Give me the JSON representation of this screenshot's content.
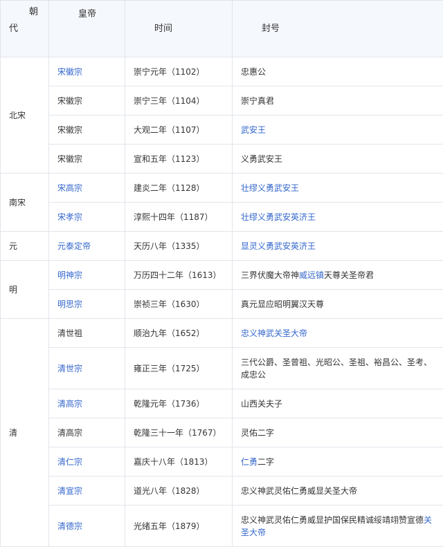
{
  "headers": {
    "dynasty_1": "朝",
    "dynasty_2": "代",
    "emperor": "皇帝",
    "time": "时间",
    "title": "封号"
  },
  "groups": [
    {
      "dynasty": "北宋",
      "rows": [
        {
          "emperor": "宋徽宗",
          "emperor_link": true,
          "time": "崇宁元年（1102）",
          "title": [
            {
              "t": "忠惠公",
              "link": false
            }
          ]
        },
        {
          "emperor": "宋徽宗",
          "emperor_link": false,
          "time": "崇宁三年（1104）",
          "title": [
            {
              "t": "崇宁真君",
              "link": false
            }
          ]
        },
        {
          "emperor": "宋徽宗",
          "emperor_link": false,
          "time": "大观二年（1107）",
          "title": [
            {
              "t": "武安王",
              "link": true
            }
          ]
        },
        {
          "emperor": "宋徽宗",
          "emperor_link": false,
          "time": "宣和五年（1123）",
          "title": [
            {
              "t": "义勇武安王",
              "link": false
            }
          ]
        }
      ]
    },
    {
      "dynasty": "南宋",
      "rows": [
        {
          "emperor": "宋高宗",
          "emperor_link": true,
          "time": "建炎二年（1128）",
          "title": [
            {
              "t": "壮缪义勇武安王",
              "link": true
            }
          ]
        },
        {
          "emperor": "宋孝宗",
          "emperor_link": true,
          "time": "淳熙十四年（1187）",
          "title": [
            {
              "t": "壮缪义勇武安英济王",
              "link": true
            }
          ]
        }
      ]
    },
    {
      "dynasty": "元",
      "rows": [
        {
          "emperor": "元泰定帝",
          "emperor_link": true,
          "time": "天历八年（1335）",
          "title": [
            {
              "t": "显灵义勇武安英济王",
              "link": true
            }
          ]
        }
      ]
    },
    {
      "dynasty": "明",
      "rows": [
        {
          "emperor": "明神宗",
          "emperor_link": true,
          "time": "万历四十二年（1613）",
          "title": [
            {
              "t": "三界伏魔大帝神",
              "link": false
            },
            {
              "t": "威远镇",
              "link": true
            },
            {
              "t": "天尊关圣帝君",
              "link": false
            }
          ]
        },
        {
          "emperor": "明思宗",
          "emperor_link": true,
          "time": "崇祯三年（1630）",
          "title": [
            {
              "t": "真元显应昭明翼汉天尊",
              "link": false
            }
          ]
        }
      ]
    },
    {
      "dynasty": "清",
      "rows": [
        {
          "emperor": "清世祖",
          "emperor_link": false,
          "time": "顺治九年（1652）",
          "title": [
            {
              "t": "忠义神武关圣大帝",
              "link": true
            }
          ]
        },
        {
          "emperor": "清世宗",
          "emperor_link": true,
          "time": "雍正三年（1725）",
          "tall": true,
          "title": [
            {
              "t": "三代公爵、圣曾祖、光昭公、圣祖、裕昌公、圣考、成忠公",
              "link": false
            }
          ]
        },
        {
          "emperor": "清高宗",
          "emperor_link": true,
          "time": "乾隆元年（1736）",
          "title": [
            {
              "t": "山西关夫子",
              "link": false
            }
          ]
        },
        {
          "emperor": "清高宗",
          "emperor_link": false,
          "time": "乾隆三十一年（1767）",
          "title": [
            {
              "t": "灵佑二字",
              "link": false
            }
          ]
        },
        {
          "emperor": "清仁宗",
          "emperor_link": true,
          "time": "嘉庆十八年（1813）",
          "title": [
            {
              "t": "仁勇",
              "link": true
            },
            {
              "t": "二字",
              "link": false
            }
          ]
        },
        {
          "emperor": "清宣宗",
          "emperor_link": true,
          "time": "道光八年（1828）",
          "title": [
            {
              "t": "忠义神武灵佑仁勇威显关圣大帝",
              "link": false
            }
          ]
        },
        {
          "emperor": "清德宗",
          "emperor_link": true,
          "time": "光绪五年（1879）",
          "tall": true,
          "title": [
            {
              "t": "忠义神武灵佑仁勇威显护国保民精诚绥靖翊赞宣德",
              "link": false
            },
            {
              "t": "关圣大帝",
              "link": true
            }
          ]
        }
      ]
    }
  ]
}
